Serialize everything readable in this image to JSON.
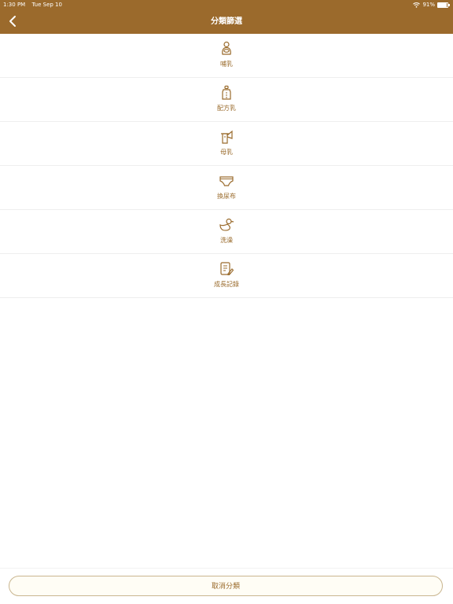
{
  "status_bar": {
    "time": "1:30 PM",
    "date": "Tue Sep 10",
    "battery_text": "91%",
    "battery_level": 0.91
  },
  "nav": {
    "title": "分類篩選",
    "back_icon": "chevron-left-icon"
  },
  "categories": [
    {
      "label": "哺乳",
      "icon": "nursing-icon"
    },
    {
      "label": "配方乳",
      "icon": "formula-bottle-icon"
    },
    {
      "label": "母乳",
      "icon": "breast-pump-icon"
    },
    {
      "label": "換尿布",
      "icon": "diaper-icon"
    },
    {
      "label": "洗澡",
      "icon": "duck-icon"
    },
    {
      "label": "成長記錄",
      "icon": "growth-record-icon"
    }
  ],
  "footer": {
    "cancel_label": "取消分類"
  },
  "colors": {
    "brand": "#9b6a2c",
    "accent_text": "#9a6b2c"
  }
}
